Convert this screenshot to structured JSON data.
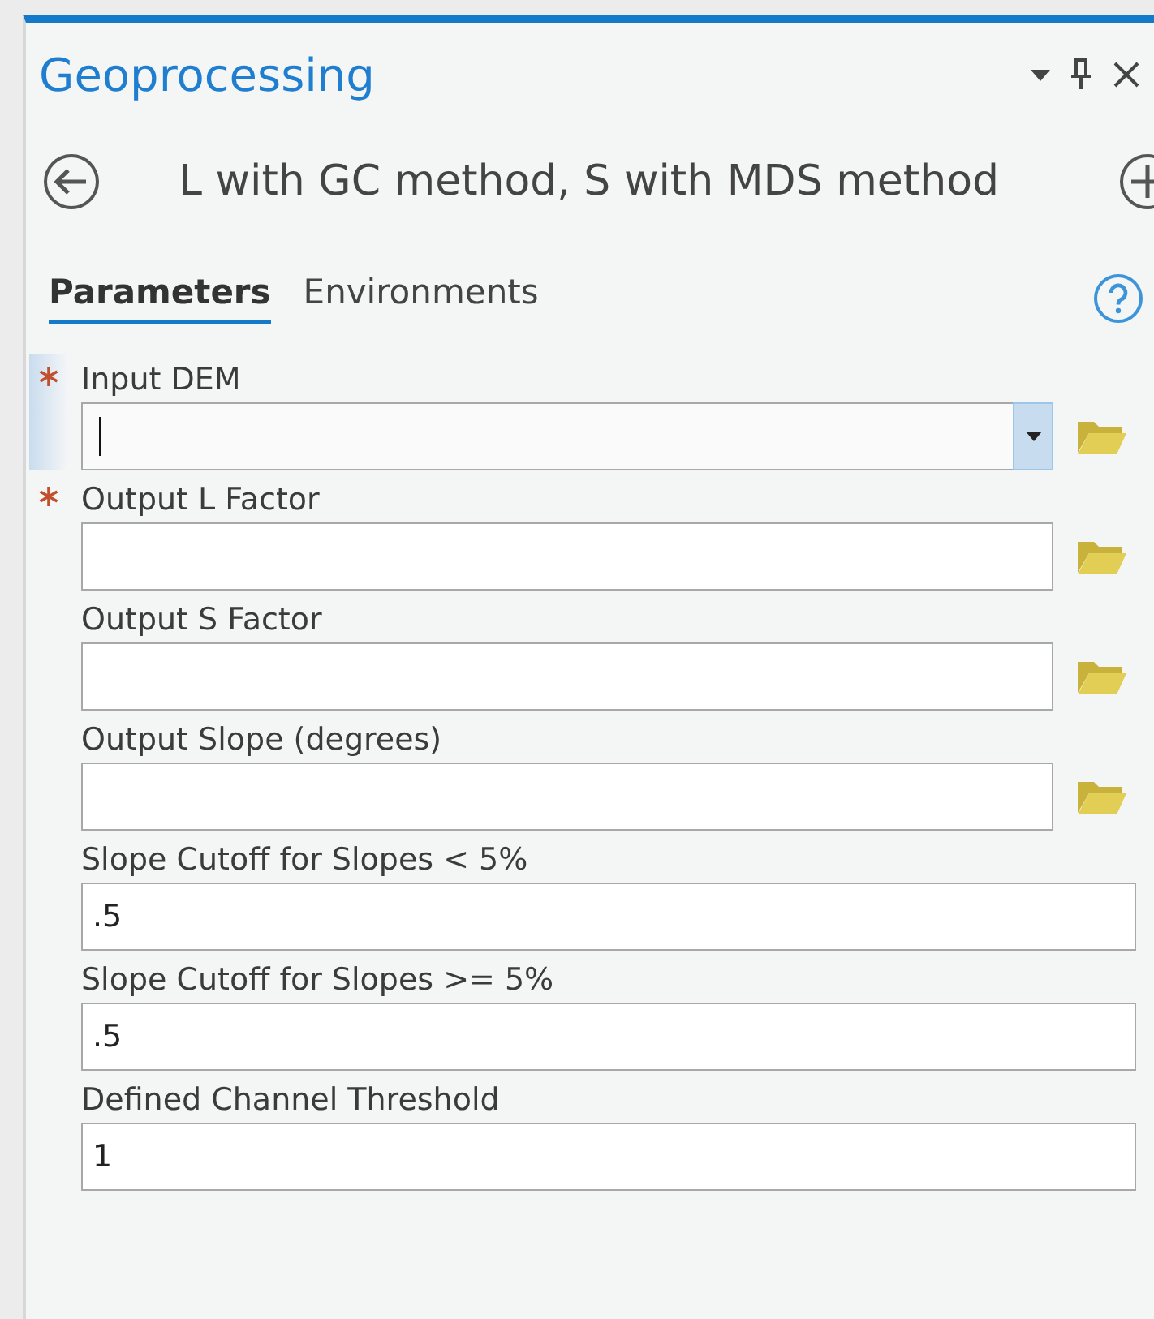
{
  "pane": {
    "title": "Geoprocessing"
  },
  "tool": {
    "name": "L with GC method, S with MDS method"
  },
  "tabs": [
    {
      "label": "Parameters",
      "selected": true
    },
    {
      "label": "Environments",
      "selected": false
    }
  ],
  "parameters": [
    {
      "label": "Input DEM",
      "kind": "dataset",
      "required": true,
      "focused": true
    },
    {
      "label": "Output L Factor",
      "kind": "output",
      "required": true,
      "focused": false
    },
    {
      "label": "Output S Factor",
      "kind": "output",
      "required": false,
      "focused": false
    },
    {
      "label": "Output Slope (degrees)",
      "kind": "output",
      "required": false,
      "focused": false
    },
    {
      "label": "Slope Cutoff for Slopes < 5%",
      "kind": "number",
      "required": false,
      "focused": false,
      "value": ".5"
    },
    {
      "label": "Slope Cutoff for Slopes >= 5%",
      "kind": "number",
      "required": false,
      "focused": false,
      "value": ".5"
    },
    {
      "label": "Defined Channel Threshold",
      "kind": "number",
      "required": false,
      "focused": false,
      "value": "1"
    }
  ]
}
